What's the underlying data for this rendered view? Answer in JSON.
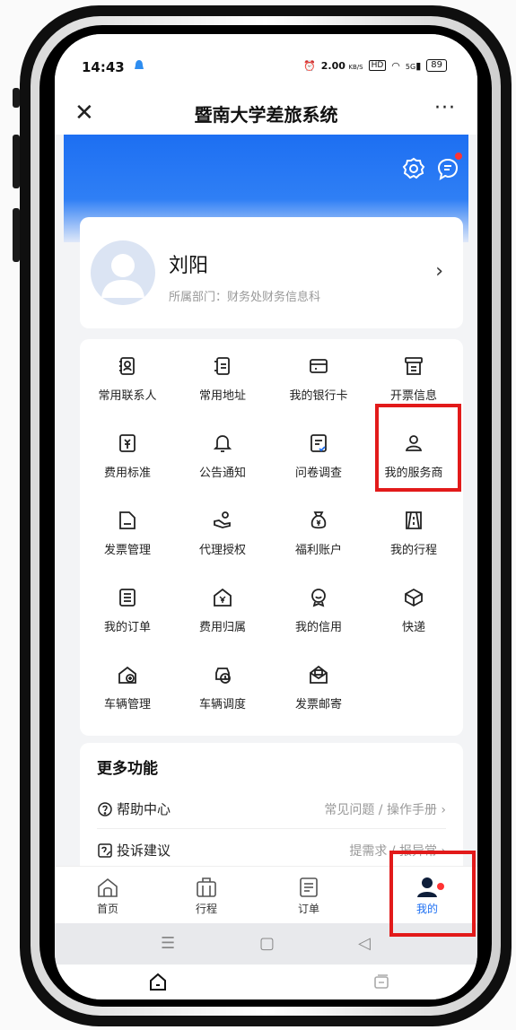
{
  "status": {
    "time": "14:43",
    "net_speed": "2.00",
    "net_unit": "KB/S",
    "hd": "HD",
    "signal": "5G",
    "battery": "89"
  },
  "titlebar": {
    "title": "暨南大学差旅系统",
    "close_glyph": "✕",
    "more_glyph": "···"
  },
  "profile": {
    "name": "刘阳",
    "department": "所属部门：财务处财务信息科",
    "chevron": "›"
  },
  "grid": [
    {
      "label": "常用联系人",
      "icon": "contacts-icon"
    },
    {
      "label": "常用地址",
      "icon": "address-icon"
    },
    {
      "label": "我的银行卡",
      "icon": "bank-card-icon"
    },
    {
      "label": "开票信息",
      "icon": "invoice-info-icon"
    },
    {
      "label": "费用标准",
      "icon": "fee-standard-icon"
    },
    {
      "label": "公告通知",
      "icon": "bell-icon"
    },
    {
      "label": "问卷调查",
      "icon": "survey-icon"
    },
    {
      "label": "我的服务商",
      "icon": "service-provider-icon"
    },
    {
      "label": "发票管理",
      "icon": "invoice-manage-icon"
    },
    {
      "label": "代理授权",
      "icon": "proxy-auth-icon"
    },
    {
      "label": "福利账户",
      "icon": "welfare-bag-icon"
    },
    {
      "label": "我的行程",
      "icon": "road-icon"
    },
    {
      "label": "我的订单",
      "icon": "order-list-icon"
    },
    {
      "label": "费用归属",
      "icon": "fee-home-icon"
    },
    {
      "label": "我的信用",
      "icon": "credit-icon"
    },
    {
      "label": "快递",
      "icon": "box-icon"
    },
    {
      "label": "车辆管理",
      "icon": "car-manage-icon"
    },
    {
      "label": "车辆调度",
      "icon": "car-dispatch-icon"
    },
    {
      "label": "发票邮寄",
      "icon": "mail-icon"
    }
  ],
  "more": {
    "title": "更多功能",
    "rows": [
      {
        "label": "帮助中心",
        "right": "常见问题 / 操作手册 ›"
      },
      {
        "label": "投诉建议",
        "right": "提需求 / 报异常 ›"
      }
    ]
  },
  "tabs": [
    {
      "label": "首页",
      "icon": "home-icon"
    },
    {
      "label": "行程",
      "icon": "suitcase-icon"
    },
    {
      "label": "订单",
      "icon": "order-icon"
    },
    {
      "label": "我的",
      "icon": "user-icon",
      "active": true
    }
  ],
  "colors": {
    "accent": "#1d6ff2",
    "highlight": "#e21a1a",
    "badge": "#ff3333"
  }
}
